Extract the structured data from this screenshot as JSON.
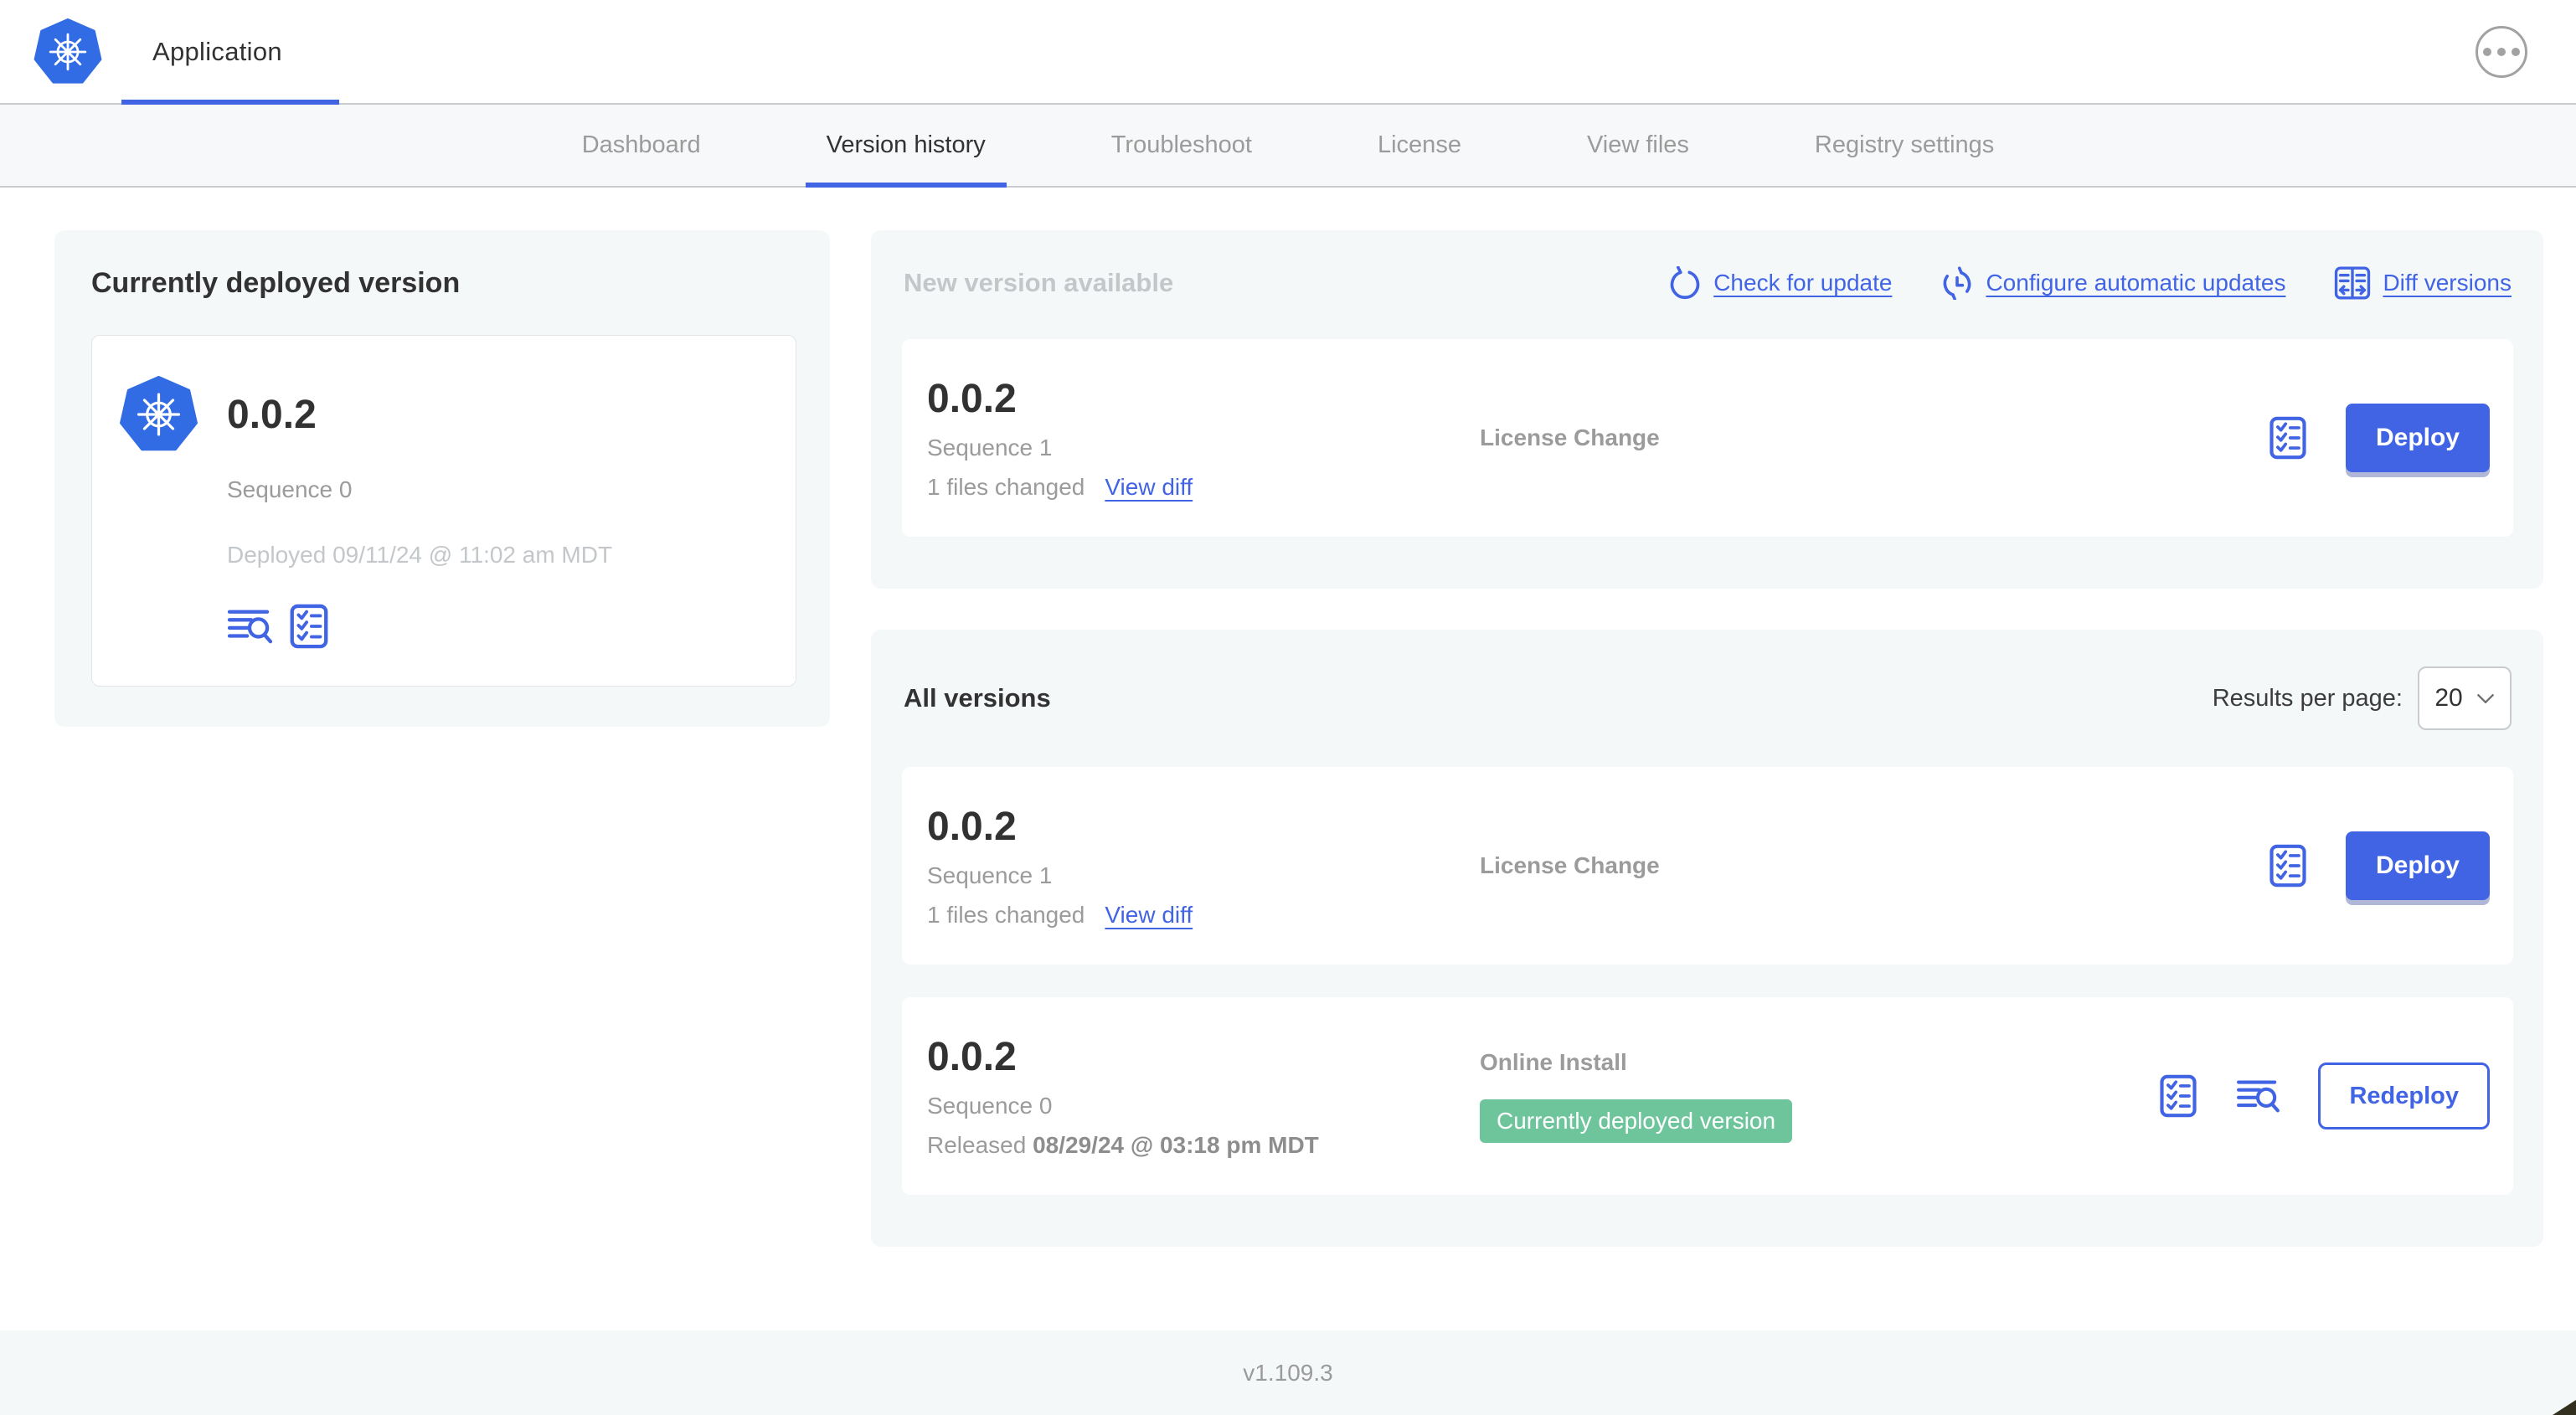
{
  "colors": {
    "accent_blue": "#4164e4",
    "kubernetes_blue": "#326ce5",
    "badge_green": "#6ec59c",
    "dark_text": "#323232",
    "muted_text": "#9b9b9b",
    "faint_text": "#c3c7ca",
    "section_bg": "#f5f8f9"
  },
  "header": {
    "title": "Application"
  },
  "nav": {
    "tabs": [
      {
        "label": "Dashboard",
        "active": false
      },
      {
        "label": "Version history",
        "active": true
      },
      {
        "label": "Troubleshoot",
        "active": false
      },
      {
        "label": "License",
        "active": false
      },
      {
        "label": "View files",
        "active": false
      },
      {
        "label": "Registry settings",
        "active": false
      }
    ]
  },
  "deployed": {
    "title": "Currently deployed version",
    "version": "0.0.2",
    "sequence": "Sequence 0",
    "deployed_at": "Deployed 09/11/24 @ 11:02 am MDT"
  },
  "new_version": {
    "title": "New version available",
    "actions": [
      {
        "label": "Check for update",
        "icon": "refresh-icon"
      },
      {
        "label": "Configure automatic updates",
        "icon": "schedule-update-icon"
      },
      {
        "label": "Diff versions",
        "icon": "diff-icon"
      }
    ],
    "card": {
      "version": "0.0.2",
      "sequence": "Sequence 1",
      "files_changed": "1 files changed",
      "view_diff": "View diff",
      "type": "License Change",
      "action": "Deploy"
    }
  },
  "all_versions": {
    "title": "All versions",
    "results_label": "Results per page:",
    "per_page": "20",
    "rows": [
      {
        "version": "0.0.2",
        "sequence": "Sequence 1",
        "files_changed": "1 files changed",
        "view_diff": "View diff",
        "type": "License Change",
        "action": "Deploy"
      },
      {
        "version": "0.0.2",
        "sequence": "Sequence 0",
        "released_prefix": "Released",
        "released_date": "08/29/24 @ 03:18 pm MDT",
        "type": "Online Install",
        "badge": "Currently deployed version",
        "action": "Redeploy"
      }
    ]
  },
  "footer": {
    "version": "v1.109.3"
  }
}
